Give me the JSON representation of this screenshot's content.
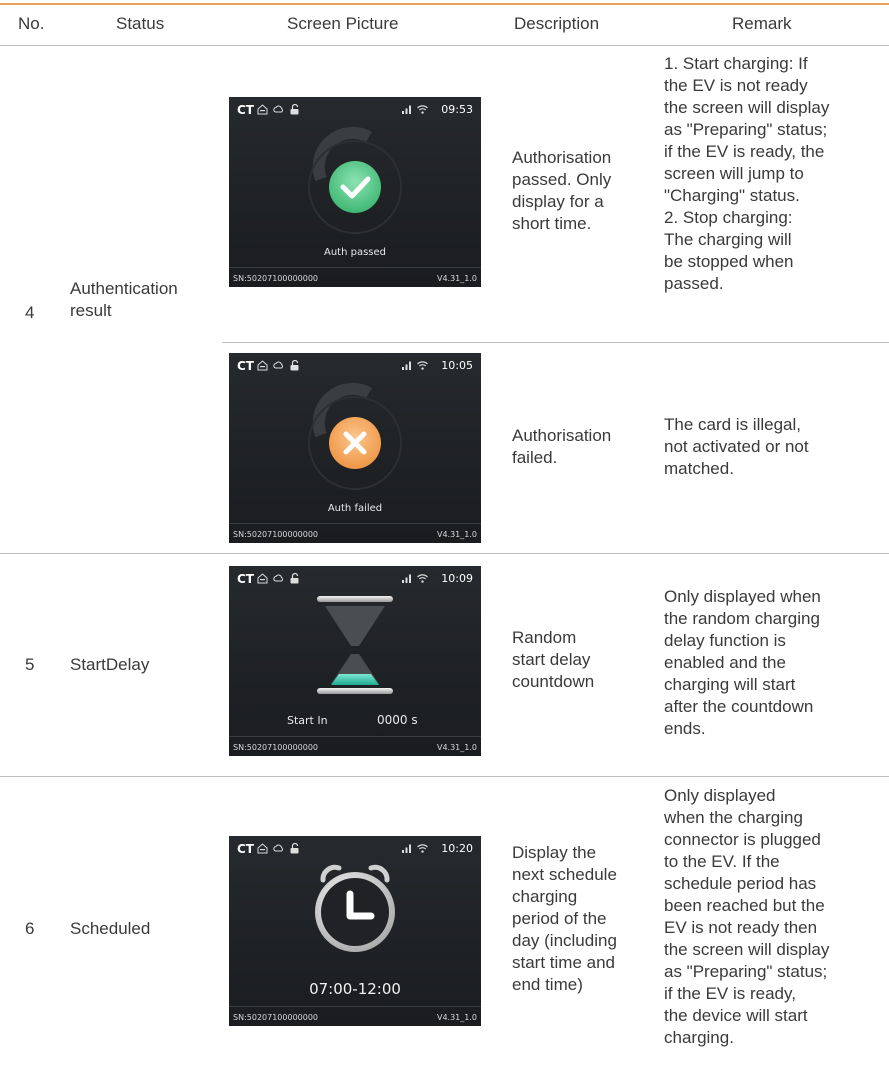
{
  "headers": {
    "no": "No.",
    "status": "Status",
    "screen_picture": "Screen Picture",
    "description": "Description",
    "remark": "Remark"
  },
  "screens": {
    "auth_passed": {
      "time": "09:53",
      "caption": "Auth passed",
      "sn": "SN:50207100000000",
      "version": "V4.31_1.0",
      "status_icon": "check-icon",
      "accent": "#5cd08a"
    },
    "auth_failed": {
      "time": "10:05",
      "caption": "Auth failed",
      "sn": "SN:50207100000000",
      "version": "V4.31_1.0",
      "status_icon": "cross-icon",
      "accent": "#f5a45a"
    },
    "start_delay": {
      "time": "10:09",
      "label": "Start In",
      "value": "0000 s",
      "sn": "SN:50207100000000",
      "version": "V4.31_1.0",
      "status_icon": "hourglass-icon",
      "accent": "#2fbfa6"
    },
    "scheduled": {
      "time": "10:20",
      "period": "07:00-12:00",
      "sn": "SN:50207100000000",
      "version": "V4.31_1.0",
      "status_icon": "alarm-clock-icon"
    },
    "ct_label": "CT"
  },
  "rows": {
    "r4": {
      "no": "4",
      "status": [
        "Authentication",
        "result"
      ],
      "passed_desc": [
        "Authorisation",
        "passed. Only",
        "display for a",
        "short time."
      ],
      "passed_remark": [
        "1. Start charging: If",
        "the EV is not ready",
        "the screen will display",
        "as \"Preparing\" status;",
        "if the EV is ready, the",
        "screen will jump to",
        "\"Charging\" status.",
        "2. Stop charging:",
        "The charging will",
        "be stopped when",
        "passed."
      ],
      "failed_desc": [
        "Authorisation",
        "failed."
      ],
      "failed_remark": [
        "The card is illegal,",
        "not activated or not",
        "matched."
      ]
    },
    "r5": {
      "no": "5",
      "status": [
        "StartDelay"
      ],
      "desc": [
        "Random",
        "start delay",
        "countdown"
      ],
      "remark": [
        "Only displayed when",
        "the random charging",
        "delay function is",
        "enabled and the",
        "charging will start",
        "after the countdown",
        "ends."
      ]
    },
    "r6": {
      "no": "6",
      "status": [
        "Scheduled"
      ],
      "desc": [
        "Display the",
        "next schedule",
        "charging",
        "period of the",
        "day (including",
        "start time and",
        "end time)"
      ],
      "remark": [
        "Only displayed",
        "when the charging",
        "connector is plugged",
        "to the EV. If the",
        "schedule period has",
        "been reached but the",
        "EV is not ready then",
        "the screen will display",
        "as \"Preparing\" status;",
        "if the EV is ready,",
        "the device will start",
        "charging."
      ]
    }
  }
}
